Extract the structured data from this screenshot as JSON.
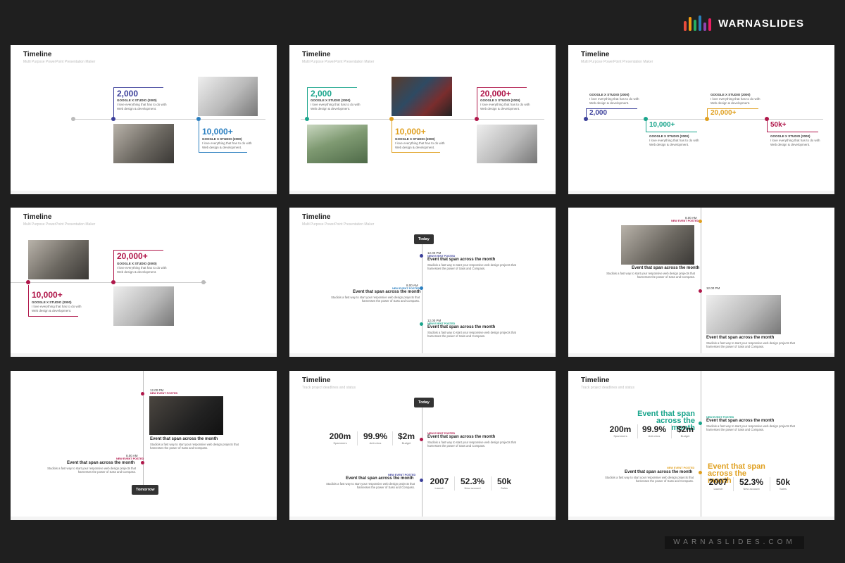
{
  "brand": {
    "name": "WARNASLIDES",
    "bar_colors": [
      "#e74c3c",
      "#f39c12",
      "#27ae60",
      "#2980b9",
      "#8e44ad",
      "#e91e63",
      "#16a085"
    ],
    "bottom_text": "WARNASLIDES.COM"
  },
  "common": {
    "title": "Timeline",
    "subtitle_maker": "Multi Purpose PowerPoint Presentation Maker",
    "subtitle_track": "Track project deadlines and status",
    "studio": "GOOGLE X STUDIO (2000)",
    "desc": "I love everything that has to do with Web design & development.",
    "today": "Today",
    "tomorrow": "Tomorrow",
    "event_posted": "NEW EVENT POSTED",
    "event_title": "Event that span across the month",
    "event_desc": "Studiois a fast way to start your responsive web design projects that harnesses the power of Sass and Compass."
  },
  "slide1": {
    "v1": "2,000",
    "v2": "10,000+"
  },
  "slide2": {
    "v1": "2,000",
    "v2": "10,000+",
    "v3": "20,000+"
  },
  "slide3": {
    "v1": "2,000",
    "v2": "10,000+",
    "v3": "20,000+",
    "v4": "50k+"
  },
  "slide4": {
    "v1": "20,000+",
    "v2": "10,000+"
  },
  "slide5": {
    "t1": "12.00 PM",
    "t2": "8.00 AM",
    "t3": "12.00 PM"
  },
  "slide6": {
    "t1": "8.00 AM",
    "t2": "12.00 PM"
  },
  "slide7": {
    "t1": "12.00 PM",
    "t2": "8.00 AM"
  },
  "slide8": {
    "stats1": [
      {
        "v": "200m",
        "l": "Spammers"
      },
      {
        "v": "99.9%",
        "l": "Anti-virus"
      },
      {
        "v": "$2m",
        "l": "Budget"
      }
    ],
    "stats2": [
      {
        "v": "2007",
        "l": "Launch"
      },
      {
        "v": "52.3%",
        "l": "New account"
      },
      {
        "v": "50k",
        "l": "Sales"
      }
    ]
  },
  "slide9": {
    "big1": "Event that span across the month",
    "big2": "Event that span across the month"
  },
  "colors": {
    "blue": "#3b3f9a",
    "teal": "#1aa58c",
    "gold": "#e0a020",
    "red": "#b0174a",
    "navy": "#2a3f8a",
    "lightblue": "#2b7fc0",
    "gray": "#bdbdbd"
  }
}
